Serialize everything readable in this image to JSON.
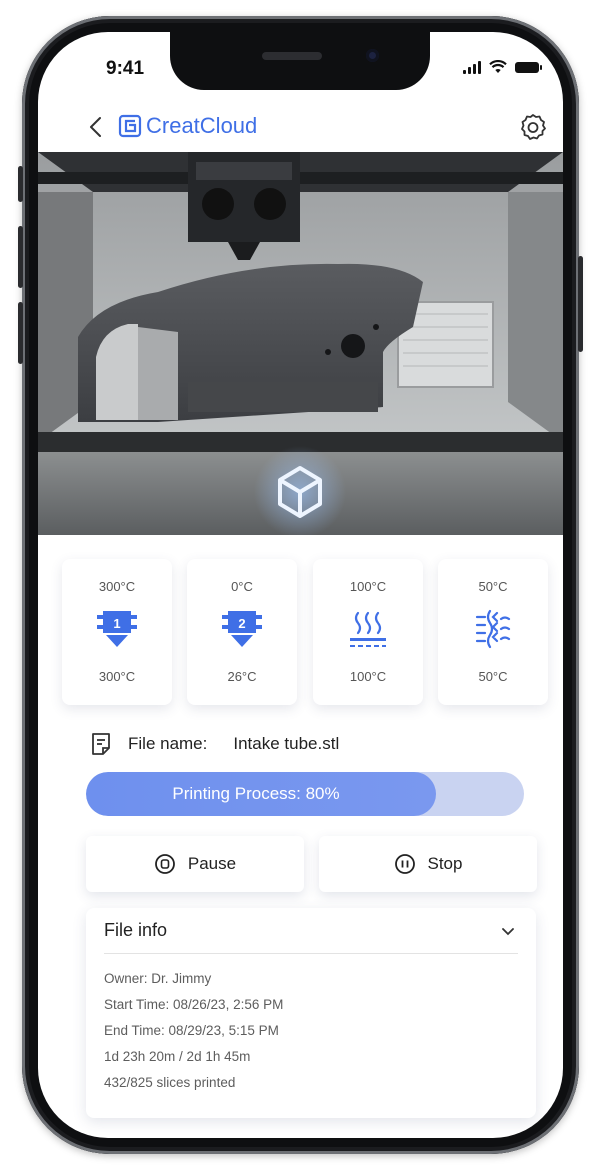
{
  "status_bar": {
    "time": "9:41"
  },
  "header": {
    "brand": "CreatCloud"
  },
  "temperatures": [
    {
      "target": "300°C",
      "current": "300°C",
      "icon": "nozzle-1-icon",
      "badge": "1"
    },
    {
      "target": "0°C",
      "current": "26°C",
      "icon": "nozzle-2-icon",
      "badge": "2"
    },
    {
      "target": "100°C",
      "current": "100°C",
      "icon": "heated-bed-icon"
    },
    {
      "target": "50°C",
      "current": "50°C",
      "icon": "chamber-icon"
    }
  ],
  "file": {
    "label": "File name:",
    "name": "Intake tube.stl"
  },
  "progress": {
    "text": "Printing Process: 80%",
    "fraction": 0.8
  },
  "controls": {
    "pause_label": "Pause",
    "stop_label": "Stop"
  },
  "file_info": {
    "title": "File info",
    "owner": "Owner: Dr. Jimmy",
    "start": "Start Time: 08/26/23, 2:56 PM",
    "end": "End Time: 08/29/23, 5:15 PM",
    "duration": "1d 23h 20m / 2d 1h 45m",
    "slices": "432/825 slices printed"
  },
  "colors": {
    "accent": "#3f6fe6",
    "progress_fill": "#7292ee",
    "progress_track": "#c9d3f1"
  }
}
